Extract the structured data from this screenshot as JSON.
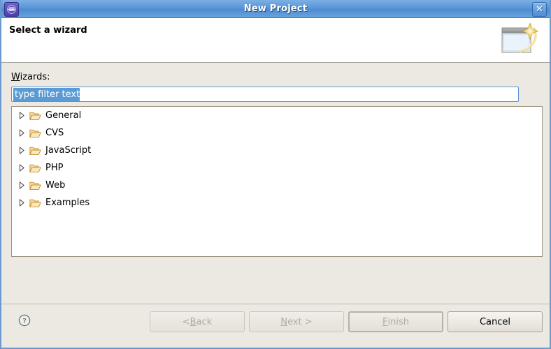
{
  "window": {
    "title": "New Project",
    "app_icon_name": "eclipse-logo-icon",
    "close_label": "✕"
  },
  "header": {
    "title": "Select a wizard",
    "description": "",
    "banner_icon_name": "new-wizard-banner-icon"
  },
  "body": {
    "wizards_label_mnemonic": "W",
    "wizards_label_rest": "izards:",
    "filter": {
      "value": "type filter text",
      "placeholder": "type filter text",
      "selected": true
    },
    "tree": {
      "items": [
        {
          "label": "General",
          "expanded": false,
          "icon": "folder-icon"
        },
        {
          "label": "CVS",
          "expanded": false,
          "icon": "folder-icon"
        },
        {
          "label": "JavaScript",
          "expanded": false,
          "icon": "folder-icon"
        },
        {
          "label": "PHP",
          "expanded": false,
          "icon": "folder-icon"
        },
        {
          "label": "Web",
          "expanded": false,
          "icon": "folder-icon"
        },
        {
          "label": "Examples",
          "expanded": false,
          "icon": "folder-icon"
        }
      ]
    }
  },
  "footer": {
    "help_icon_name": "help-question-icon",
    "buttons": [
      {
        "name": "back-button",
        "prefix": "< ",
        "mnemonic": "B",
        "suffix": "ack",
        "disabled": true,
        "default": false
      },
      {
        "name": "next-button",
        "prefix": "",
        "mnemonic": "N",
        "suffix": "ext >",
        "disabled": true,
        "default": false
      },
      {
        "name": "finish-button",
        "prefix": "",
        "mnemonic": "F",
        "suffix": "inish",
        "disabled": true,
        "default": true
      },
      {
        "name": "cancel-button",
        "prefix": "",
        "mnemonic": "",
        "suffix": "Cancel",
        "disabled": false,
        "default": false
      }
    ]
  },
  "colors": {
    "titlebar_blue": "#5a95d8",
    "dialog_bg": "#ece9e3",
    "selection_blue": "#5b9bd5",
    "folder_orange": "#e8a33d",
    "tree_border": "#9d9384"
  }
}
